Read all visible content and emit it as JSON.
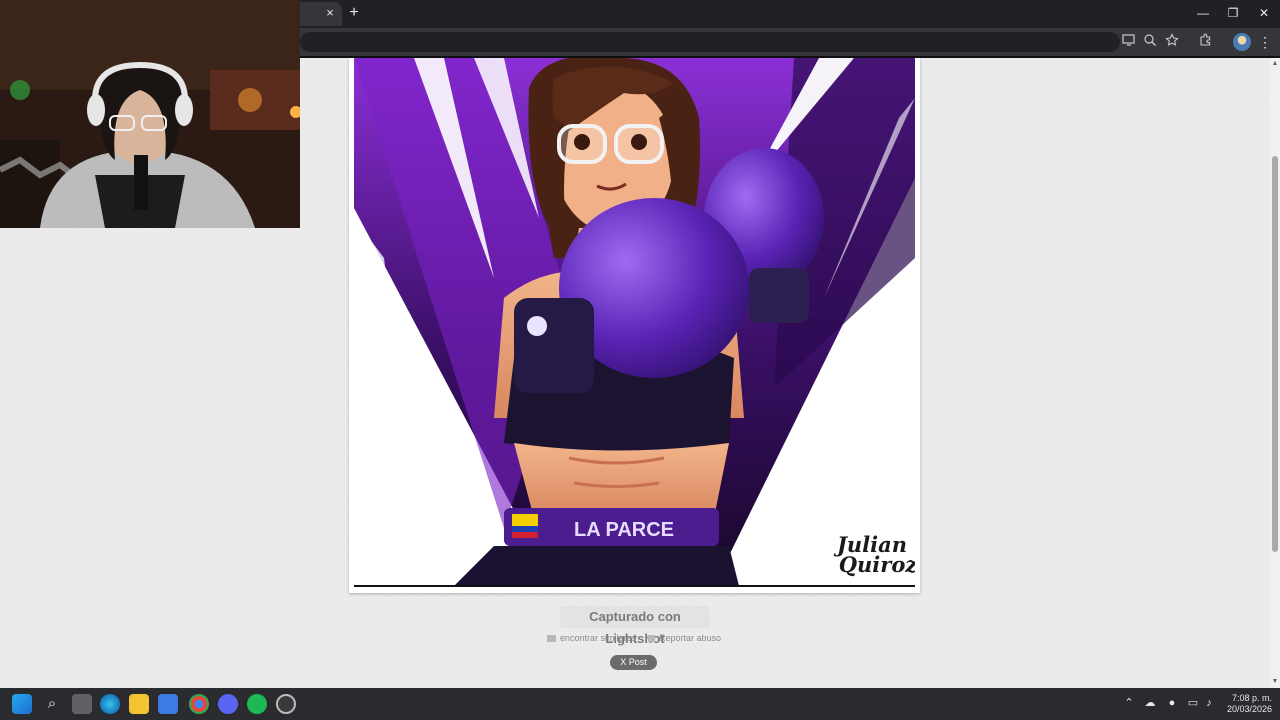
{
  "browser": {
    "tab_close": "×",
    "new_tab": "+",
    "window_controls": {
      "minimize": "—",
      "restore": "❐",
      "close": "✕"
    },
    "toolbar_icons": [
      "install-app-icon",
      "zoom-icon",
      "bookmark-star-icon",
      "extensions-icon"
    ],
    "menu": "⋮"
  },
  "page": {
    "image_signature_line1": "Julian",
    "image_signature_line2": "Quiroz",
    "belt_text": "LA PARCE",
    "caption": "Capturado con Lightshot",
    "find_similar": "encontrar similares",
    "report_abuse": "Reportar abuso",
    "post_button": "X  Post"
  },
  "taskbar": {
    "time": "7:08 p. m.",
    "date": "20/03/2026",
    "apps": [
      "windows-start-icon",
      "search-icon",
      "task-view-icon",
      "edge-icon",
      "file-explorer-icon",
      "store-icon",
      "chrome-icon",
      "discord-icon",
      "spotify-icon",
      "obs-icon"
    ]
  },
  "colors": {
    "purple": "#6a1fb3",
    "dark_purple": "#2d0b4f",
    "glove": "#5b22b8",
    "skin": "#e9a87f"
  }
}
